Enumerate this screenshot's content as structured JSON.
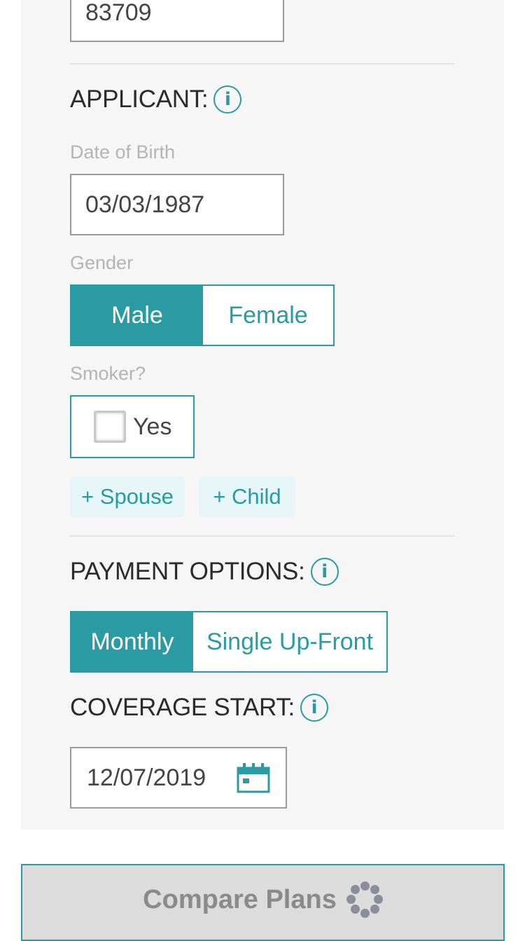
{
  "zip": {
    "value": "83709"
  },
  "applicant": {
    "title": "APPLICANT:",
    "dob_label": "Date of Birth",
    "dob_value": "03/03/1987",
    "gender_label": "Gender",
    "gender_options": [
      "Male",
      "Female"
    ],
    "gender_selected": "Male",
    "smoker_label": "Smoker?",
    "smoker_option": "Yes",
    "smoker_checked": false,
    "add_spouse": "+ Spouse",
    "add_child": "+ Child"
  },
  "payment": {
    "title": "PAYMENT OPTIONS:",
    "options": [
      "Monthly",
      "Single Up-Front"
    ],
    "selected": "Monthly"
  },
  "coverage": {
    "title": "COVERAGE START:",
    "date": "12/07/2019"
  },
  "compare_button": {
    "label": "Compare Plans"
  },
  "icons": {
    "info": "info-icon",
    "calendar": "calendar-icon",
    "spinner": "loading-spinner-icon"
  },
  "colors": {
    "accent": "#2a9aa3",
    "panel": "#f6f6f6",
    "pill_bg": "#e6f5f8",
    "button_disabled": "#dcdcdc"
  }
}
